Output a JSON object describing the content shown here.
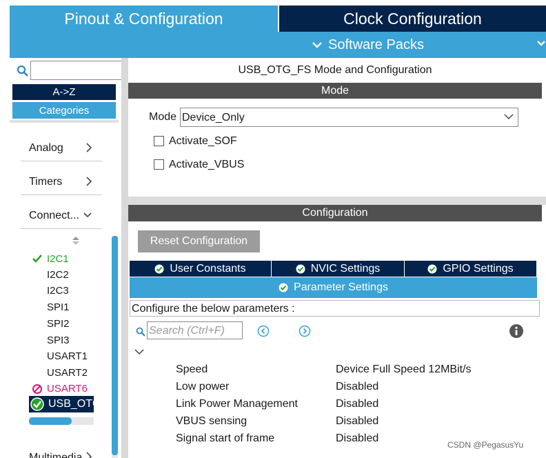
{
  "tabs": {
    "pinout": "Pinout & Configuration",
    "clock": "Clock Configuration",
    "software_packs": "Software Packs"
  },
  "left": {
    "az_label": "A->Z",
    "categories_label": "Categories",
    "categories": [
      {
        "label": "Analog",
        "expanded": false
      },
      {
        "label": "Timers",
        "expanded": false
      },
      {
        "label": "Connect...",
        "expanded": true
      }
    ],
    "peripherals": [
      {
        "label": "I2C1",
        "status": "enabled"
      },
      {
        "label": "I2C2",
        "status": "none"
      },
      {
        "label": "I2C3",
        "status": "none"
      },
      {
        "label": "SPI1",
        "status": "none"
      },
      {
        "label": "SPI2",
        "status": "none"
      },
      {
        "label": "SPI3",
        "status": "none"
      },
      {
        "label": "USART1",
        "status": "none"
      },
      {
        "label": "USART2",
        "status": "none"
      },
      {
        "label": "USART6",
        "status": "disabled"
      }
    ],
    "selected_peripheral": "USB_OTG_FS",
    "next_category": "Multimedia"
  },
  "mode_panel": {
    "title": "USB_OTG_FS Mode and Configuration",
    "header": "Mode",
    "mode_label": "Mode",
    "mode_value": "Device_Only",
    "activate_sof": "Activate_SOF",
    "activate_vbus": "Activate_VBUS"
  },
  "config_panel": {
    "header": "Configuration",
    "reset_button": "Reset Configuration",
    "tabs": [
      "User Constants",
      "NVIC Settings",
      "GPIO Settings"
    ],
    "active_tab": "Parameter Settings",
    "description": "Configure the below parameters :",
    "search_placeholder": "Search (Ctrl+F)",
    "params": [
      {
        "name": "Speed",
        "value": "Device Full Speed 12MBit/s"
      },
      {
        "name": "Low power",
        "value": "Disabled"
      },
      {
        "name": "Link Power Management",
        "value": "Disabled"
      },
      {
        "name": "VBUS sensing",
        "value": "Disabled"
      },
      {
        "name": "Signal start of frame",
        "value": "Disabled"
      }
    ]
  },
  "watermark": "CSDN @PegasusYu",
  "colors": {
    "accent_blue": "#3ba3d5",
    "navy": "#03234b",
    "header_gray": "#505050",
    "enabled_green": "#2aa12a",
    "disabled_red": "#d2187a"
  }
}
